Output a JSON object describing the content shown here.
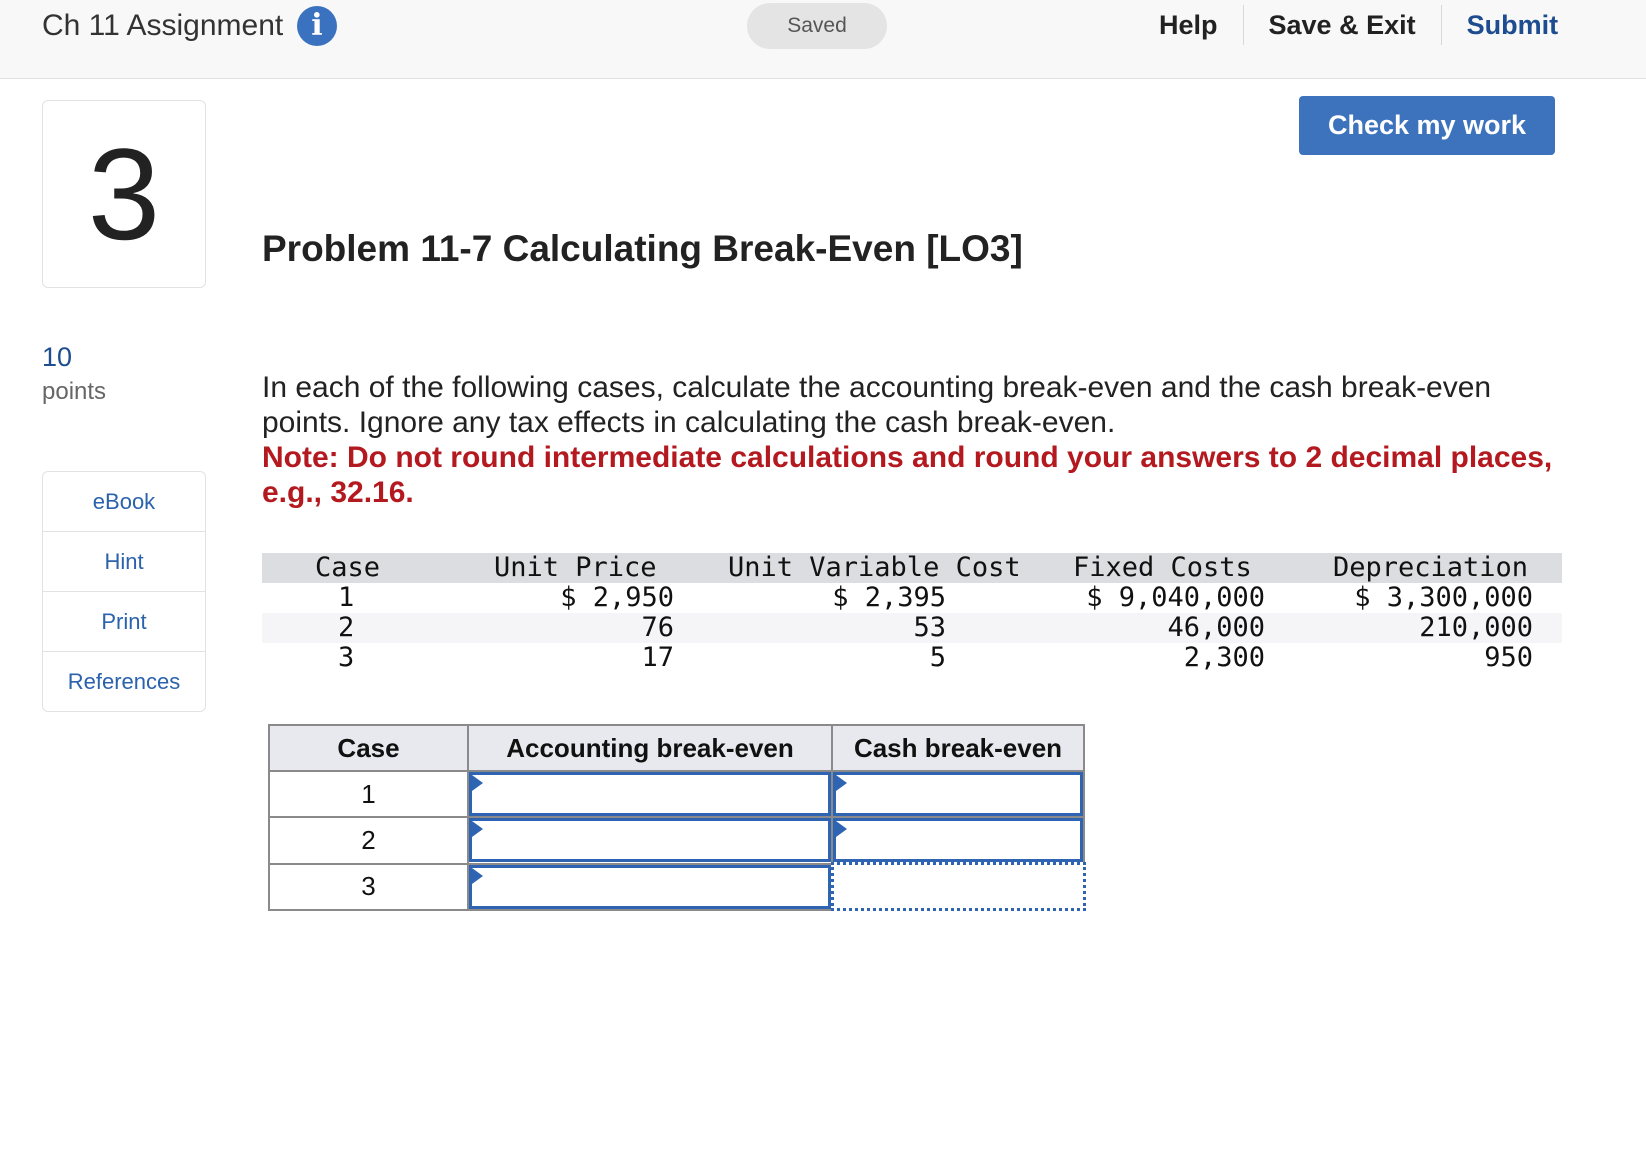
{
  "header": {
    "assignment_title": "Ch 11 Assignment",
    "status": "Saved",
    "nav": {
      "help": "Help",
      "save_exit": "Save & Exit",
      "submit": "Submit"
    }
  },
  "question": {
    "number": "3",
    "points_value": "10",
    "points_label": "points"
  },
  "tools": {
    "ebook": "eBook",
    "hint": "Hint",
    "print": "Print",
    "references": "References"
  },
  "check_button": "Check my work",
  "problem": {
    "title": "Problem 11-7 Calculating Break-Even [LO3]",
    "instructions": "In each of the following cases, calculate the accounting break-even and the cash break-even points. Ignore any tax effects in calculating the cash break-even.",
    "note": "Note: Do not round intermediate calculations and round your answers to 2 decimal places, e.g., 32.16."
  },
  "data_table": {
    "headers": [
      "Case",
      "Unit Price",
      "Unit Variable Cost",
      "Fixed Costs",
      "Depreciation"
    ],
    "rows": [
      [
        "1",
        "$ 2,950",
        "$ 2,395",
        "$ 9,040,000",
        "$ 3,300,000"
      ],
      [
        "2",
        "76",
        "53",
        "46,000",
        "210,000"
      ],
      [
        "3",
        "17",
        "5",
        "2,300",
        "950"
      ]
    ]
  },
  "answer_table": {
    "headers": [
      "Case",
      "Accounting break-even",
      "Cash break-even"
    ],
    "rows": [
      {
        "case": "1",
        "accounting": "",
        "cash": ""
      },
      {
        "case": "2",
        "accounting": "",
        "cash": ""
      },
      {
        "case": "3",
        "accounting": "",
        "cash": ""
      }
    ]
  },
  "colors": {
    "accent_blue": "#3d73bd",
    "link_blue": "#2b62ad",
    "note_red": "#b3191f"
  }
}
